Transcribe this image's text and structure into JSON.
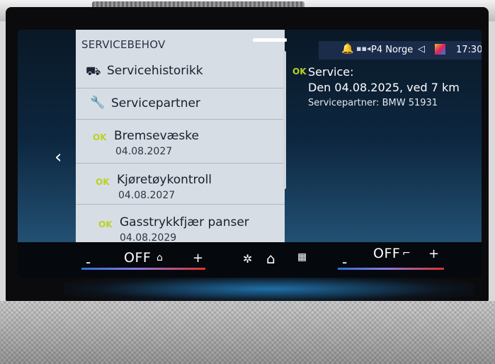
{
  "service_list": {
    "header": "SERVICEBEHOV",
    "items": [
      {
        "icon": "car-book-icon",
        "label": "Servicehistorikk"
      },
      {
        "icon": "wrench-icon",
        "label": "Servicepartner"
      },
      {
        "status": "OK",
        "label": "Bremsevæske",
        "date": "04.08.2027"
      },
      {
        "status": "OK",
        "label": "Kjøretøykontroll",
        "date": "04.08.2027"
      },
      {
        "status": "OK",
        "label": "Gasstrykkfjær panser",
        "date": "04.08.2029"
      }
    ]
  },
  "status_bar": {
    "radio_station": "P4 Norge",
    "time": "17:30"
  },
  "detail": {
    "status": "OK",
    "title": "Service:",
    "due": "Den 04.08.2025, ved 7 km",
    "partner": "Servicepartner: BMW 51931"
  },
  "climate": {
    "left": {
      "minus": "-",
      "value": "OFF",
      "plus": "+"
    },
    "right": {
      "minus": "-",
      "value": "OFF",
      "plus": "+"
    }
  },
  "colors": {
    "ok_green": "#b9d21e",
    "panel_bg": "#d7dde5",
    "status_bar_bg": "#1a2c4a"
  }
}
